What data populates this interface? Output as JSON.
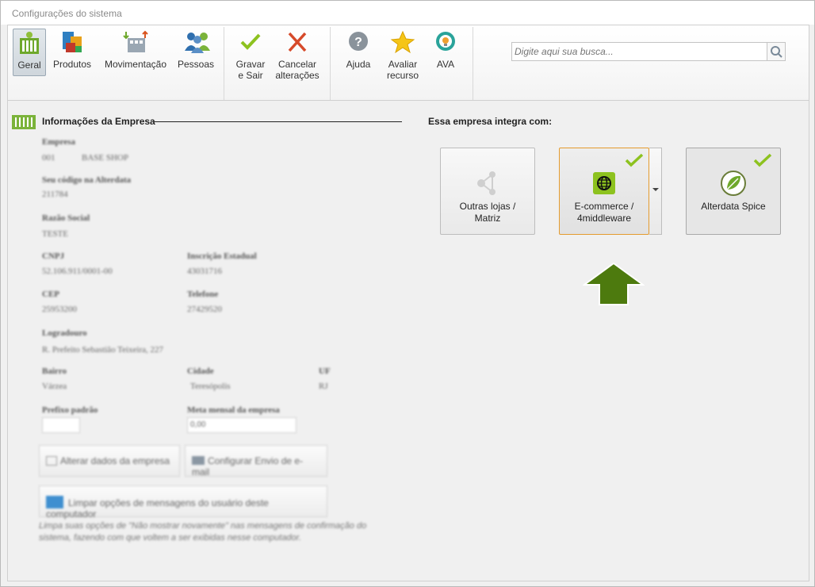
{
  "window": {
    "title": "Configurações do sistema"
  },
  "ribbon": {
    "buttons": [
      {
        "label": "Geral"
      },
      {
        "label": "Produtos"
      },
      {
        "label": "Movimentação"
      },
      {
        "label": "Pessoas"
      },
      {
        "label": "Gravar\ne Sair"
      },
      {
        "label": "Cancelar\nalterações"
      },
      {
        "label": "Ajuda"
      },
      {
        "label": "Avaliar\nrecurso"
      },
      {
        "label": "AVA"
      }
    ],
    "active": "Geral"
  },
  "search": {
    "placeholder": "Digite aqui sua busca..."
  },
  "empresa": {
    "section_title": "Informações da Empresa",
    "fields": {
      "empresa_label": "Empresa",
      "empresa_code": "001",
      "empresa_name": "BASE SHOP",
      "codigo_label": "Seu código na Alterdata",
      "codigo_value": "211784",
      "razao_label": "Razão Social",
      "razao_value": "TESTE",
      "cnpj_label": "CNPJ",
      "cnpj_value": "52.106.911/0001-00",
      "ie_label": "Inscrição Estadual",
      "ie_value": "43031716",
      "cep_label": "CEP",
      "cep_value": "25953200",
      "telefone_label": "Telefone",
      "telefone_value": "27429520",
      "logradouro_label": "Logradouro",
      "logradouro_value": "R. Prefeito Sebastião Teixeira, 227",
      "bairro_label": "Bairro",
      "bairro_value": "Várzea",
      "cidade_label": "Cidade",
      "cidade_value": "Teresópolis",
      "uf_label": "UF",
      "uf_value": "RJ",
      "prefixo_label": "Prefixo padrão",
      "prefixo_value": "",
      "meta_label": "Meta mensal da empresa",
      "meta_value": "0,00"
    },
    "buttons": {
      "alterar": "Alterar dados da empresa",
      "email": "Configurar Envio de e-mail",
      "limpar": "Limpar opções de mensagens do usuário deste computador"
    },
    "note": "Limpa suas opções de \"Não mostrar novamente\" nas mensagens de confirmação do sistema, fazendo com que voltem a ser exibidas nesse computador."
  },
  "integracao": {
    "title": "Essa empresa integra com:",
    "cards": [
      {
        "label": "Outras lojas /\nMatriz",
        "checked": false
      },
      {
        "label": "E-commerce /\n4middleware",
        "checked": true,
        "selected": true
      },
      {
        "label": "Alterdata Spice",
        "checked": true
      }
    ]
  },
  "colors": {
    "accent_green": "#8dc21f",
    "arrow_green": "#4d7a0e",
    "selection_orange": "#e49b2e"
  }
}
